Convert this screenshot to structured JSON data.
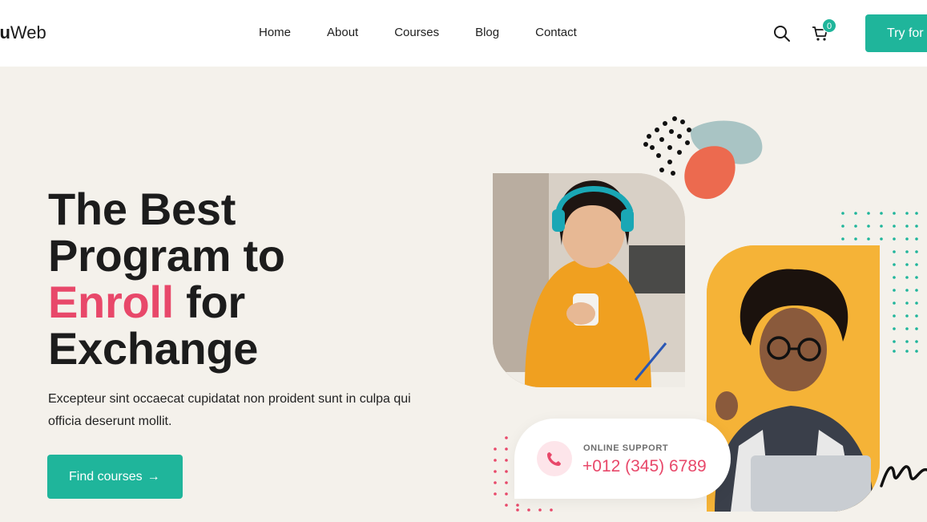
{
  "navbar": {
    "logo_prefix": "du",
    "logo_suffix": "Web",
    "links": [
      "Home",
      "About",
      "Courses",
      "Blog",
      "Contact"
    ],
    "cart_count": "0",
    "cta_label": "Try for"
  },
  "hero": {
    "title_line1": "The Best",
    "title_line2": "Program to",
    "title_accent": "Enroll",
    "title_line3_rest": " for",
    "title_line4": "Exchange",
    "description": "Excepteur sint occaecat cupidatat non proident sunt in culpa qui officia deserunt mollit.",
    "button_label": "Find courses"
  },
  "support": {
    "label": "ONLINE SUPPORT",
    "phone": "+012 (345) 6789"
  },
  "colors": {
    "accent_green": "#1fb59b",
    "accent_pink": "#e8486a",
    "background": "#f4f1eb"
  }
}
